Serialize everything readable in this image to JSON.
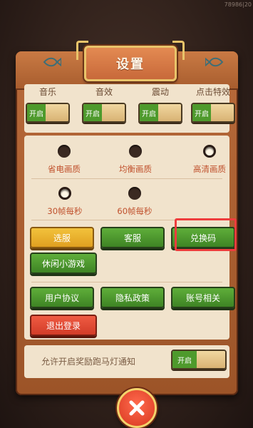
{
  "corner_text": "78986|20",
  "dialog": {
    "title": "设置"
  },
  "toggles": [
    {
      "label": "音乐",
      "state": "开启"
    },
    {
      "label": "音效",
      "state": "开启"
    },
    {
      "label": "震动",
      "state": "开启"
    },
    {
      "label": "点击特效",
      "state": "开启"
    }
  ],
  "quality_options": [
    {
      "label": "省电画质",
      "selected": false
    },
    {
      "label": "均衡画质",
      "selected": false
    },
    {
      "label": "高清画质",
      "selected": true
    }
  ],
  "fps_options": [
    {
      "label": "30帧每秒",
      "selected": true
    },
    {
      "label": "60帧每秒",
      "selected": false
    }
  ],
  "buttons": {
    "select_server": "选服",
    "customer_service": "客服",
    "redeem_code": "兑换码",
    "mini_games": "休闲小游戏",
    "user_agreement": "用户协议",
    "privacy_policy": "隐私政策",
    "account": "账号相关",
    "logout": "退出登录"
  },
  "notification": {
    "label": "允许开启奖励跑马灯通知",
    "state": "开启"
  },
  "colors": {
    "accent_green": "#4e9a2c",
    "highlight_red": "#ee3d3d",
    "wood": "#b86a3a"
  },
  "icons": {
    "close": "close-icon",
    "fish": "fish-icon"
  }
}
